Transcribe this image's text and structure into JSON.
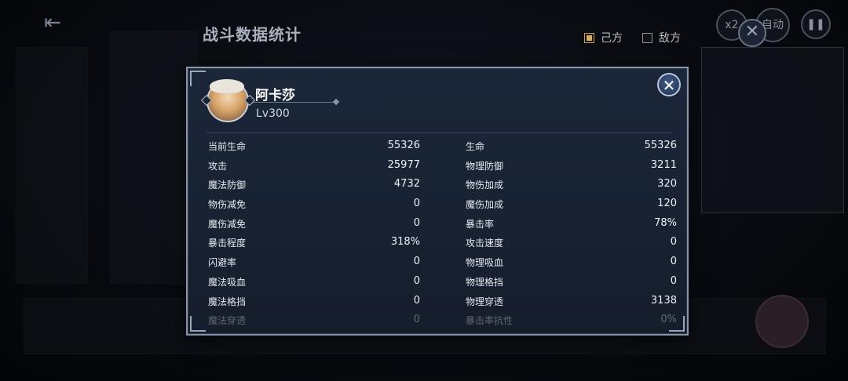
{
  "header": {
    "title": "战斗数据统计",
    "back_icon": "exit-icon"
  },
  "side_filter": {
    "own_label": "己方",
    "own_checked": true,
    "enemy_label": "敌方",
    "enemy_checked": false,
    "accent": "#d8b05a"
  },
  "hud": {
    "speed_label": "x2",
    "auto_label": "自动",
    "pause_icon": "pause-icon"
  },
  "detail": {
    "name": "阿卡莎",
    "level": "Lv300",
    "close_icon": "close-icon",
    "stats": [
      {
        "k1": "当前生命",
        "v1": "55326",
        "k2": "生命",
        "v2": "55326"
      },
      {
        "k1": "攻击",
        "v1": "25977",
        "k2": "物理防御",
        "v2": "3211"
      },
      {
        "k1": "魔法防御",
        "v1": "4732",
        "k2": "物伤加成",
        "v2": "320"
      },
      {
        "k1": "物伤减免",
        "v1": "0",
        "k2": "魔伤加成",
        "v2": "120"
      },
      {
        "k1": "魔伤减免",
        "v1": "0",
        "k2": "暴击率",
        "v2": "78%"
      },
      {
        "k1": "暴击程度",
        "v1": "318%",
        "k2": "攻击速度",
        "v2": "0"
      },
      {
        "k1": "闪避率",
        "v1": "0",
        "k2": "物理吸血",
        "v2": "0"
      },
      {
        "k1": "魔法吸血",
        "v1": "0",
        "k2": "物理格挡",
        "v2": "0"
      },
      {
        "k1": "魔法格挡",
        "v1": "0",
        "k2": "物理穿透",
        "v2": "3138"
      },
      {
        "k1": "魔法穿透",
        "v1": "0",
        "k2": "暴击率抗性",
        "v2": "0%"
      }
    ]
  }
}
